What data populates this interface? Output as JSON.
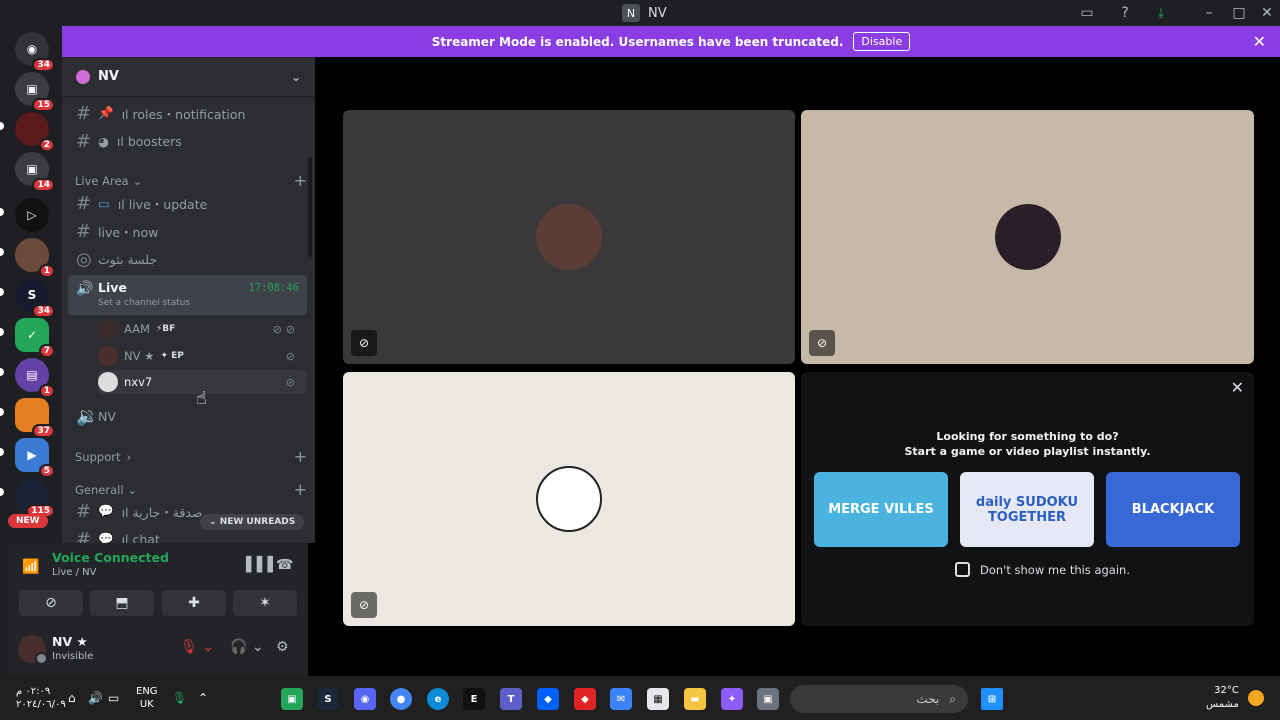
{
  "window": {
    "title": "NV",
    "app_icon": "N"
  },
  "banner": {
    "message": "Streamer Mode is enabled. Usernames have been truncated.",
    "disable_label": "Disable"
  },
  "rail": {
    "badges": [
      "34",
      "15",
      "2",
      "14",
      "1",
      "34",
      "7",
      "1",
      "37",
      "5",
      "115"
    ],
    "new_label": "NEW"
  },
  "guild": {
    "name": "NV"
  },
  "channels": {
    "roles": "ıl roles・notification",
    "boosters": "ıl boosters",
    "cat_live_area": "Live Area",
    "live_update": "ıl live・update",
    "live_now": "live・now",
    "jalsa": "جلسة بثوث",
    "voice_live": {
      "name": "Live",
      "status": "Set a channel status",
      "timer": "17:08:46"
    },
    "voice_users": [
      {
        "name": "AAM",
        "tag": "⚡BF"
      },
      {
        "name": "NV ★",
        "tag": "✦ EP"
      },
      {
        "name": "nxv7",
        "tag": ""
      }
    ],
    "voice_nv": "NV",
    "cat_support": "Support",
    "cat_general": "Generall",
    "general_partial": "ıl صدقة・جارية",
    "chat_partial": "ıl chat"
  },
  "new_unreads": "NEW UNREADS",
  "voice_panel": {
    "title": "Voice Connected",
    "subtitle": "Live / NV"
  },
  "user_panel": {
    "name": "NV ★",
    "status": "Invisible"
  },
  "activity": {
    "line1": "Looking for something to do?",
    "line2": "Start a game or video playlist instantly.",
    "games": [
      "MERGE VILLES",
      "daily SUDOKU TOGETHER",
      "BLACKJACK"
    ],
    "dont_show": "Don't show me this again."
  },
  "taskbar": {
    "time": "٠٢:٠٩ م",
    "date": "٢٠٢٤/٠٦/٠٩",
    "lang1": "ENG",
    "lang2": "UK",
    "search_placeholder": "بحث",
    "temp": "32°C",
    "weather": "مشمس"
  },
  "colors": {
    "banner": "#8b3de4",
    "connected": "#23a55a",
    "badge": "#da373c"
  }
}
